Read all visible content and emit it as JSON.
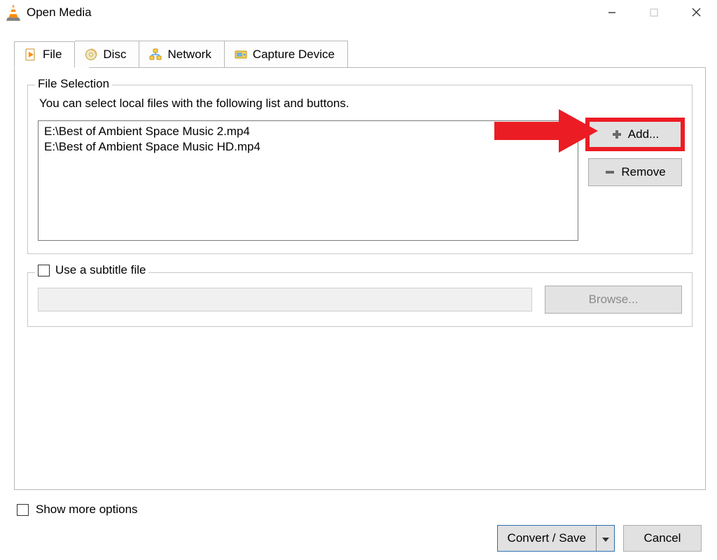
{
  "window": {
    "title": "Open Media"
  },
  "tabs": {
    "file": "File",
    "disc": "Disc",
    "network": "Network",
    "capture": "Capture Device"
  },
  "file_selection": {
    "legend": "File Selection",
    "hint": "You can select local files with the following list and buttons.",
    "files": [
      "E:\\Best of Ambient Space Music 2.mp4",
      "E:\\Best of Ambient Space Music HD.mp4"
    ],
    "add_label": "Add...",
    "remove_label": "Remove"
  },
  "subtitle": {
    "checkbox_label": "Use a subtitle file",
    "browse_label": "Browse..."
  },
  "show_more_label": "Show more options",
  "actions": {
    "primary": "Convert / Save",
    "cancel": "Cancel"
  },
  "annotation": {
    "arrow_color": "#ec1c24"
  }
}
